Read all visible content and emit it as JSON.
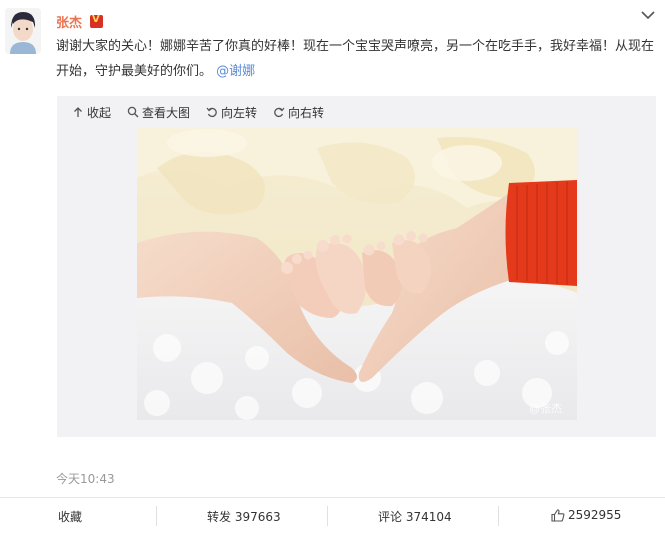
{
  "post": {
    "username": "张杰",
    "text_main": "谢谢大家的关心！娜娜辛苦了你真的好棒！现在一个宝宝哭声嘹亮，另一个在吃手手，我好幸福！从现在开始，守护最美好的你们。",
    "mention": "@谢娜",
    "timestamp": "今天10:43"
  },
  "media_toolbar": {
    "collapse": "收起",
    "view_large": "查看大图",
    "rotate_left": "向左转",
    "rotate_right": "向右转"
  },
  "photo": {
    "description_icon": "baby-feet-heart-photo",
    "watermark": "@张杰"
  },
  "actions": {
    "favorite": "收藏",
    "repost": "转发 397663",
    "comment": "评论 374104",
    "like": "2592955"
  },
  "colors": {
    "username": "#eb7350",
    "mention": "#5b8bd7",
    "sweater": "#e4391b"
  }
}
